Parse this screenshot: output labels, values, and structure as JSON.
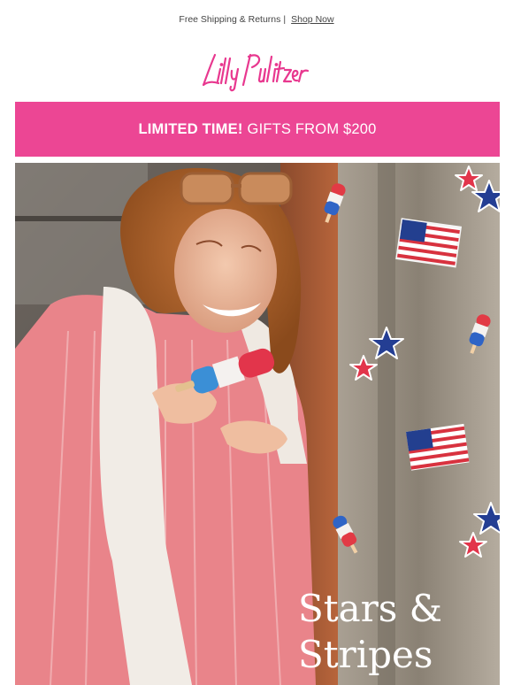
{
  "topbar": {
    "text": "Free Shipping & Returns",
    "separator": "|",
    "link": "Shop Now"
  },
  "brand": {
    "name": "Lilly Pulitzer",
    "color": "#e8388f"
  },
  "banner": {
    "bold": "LIMITED TIME!",
    "text": "GIFTS FROM $200",
    "bg": "#ec4694"
  },
  "hero": {
    "title_line1": "Stars &",
    "title_line2": "Stripes"
  }
}
